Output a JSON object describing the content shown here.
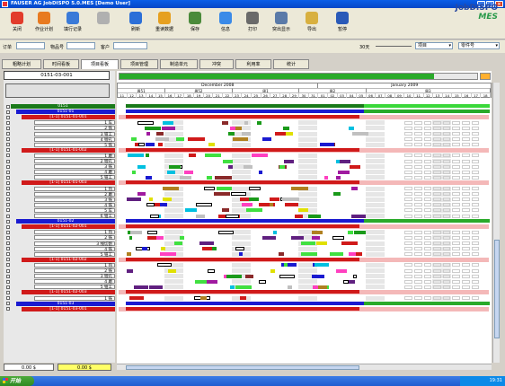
{
  "window": {
    "title": "FAUSER AG JobDISPO 5.0.MES    [Demo User]"
  },
  "toolbar": {
    "items": [
      {
        "label": "关闭",
        "color": "#e23c2b",
        "icon": "exit-icon"
      },
      {
        "label": "作业计划",
        "color": "#e87a20",
        "icon": "plan-icon"
      },
      {
        "label": "填行记录",
        "color": "#3a7ad8",
        "icon": "record-icon"
      },
      {
        "label": "",
        "color": "#b0b0b0",
        "icon": "disabled-icon"
      },
      {
        "label": "刷新",
        "color": "#2b6fd8",
        "icon": "refresh-icon"
      },
      {
        "label": "重读数据",
        "color": "#e6a020",
        "icon": "reload-icon"
      },
      {
        "label": "保存",
        "color": "#4a8a3a",
        "icon": "save-icon"
      },
      {
        "label": "信息",
        "color": "#3a8ae8",
        "icon": "info-icon"
      },
      {
        "label": "打印",
        "color": "#6a6a6a",
        "icon": "print-icon"
      },
      {
        "label": "突出显示",
        "color": "#5a7aa8",
        "icon": "highlight-icon"
      },
      {
        "label": "导出",
        "color": "#d8b040",
        "icon": "export-icon"
      },
      {
        "label": "暂停",
        "color": "#2a5ab8",
        "icon": "pause-icon"
      }
    ]
  },
  "logo": {
    "line1": "JobDISPO",
    "line2": "MES"
  },
  "filters": {
    "order_label": "订单",
    "order_placeholder": "",
    "project_label": "物品号",
    "project_placeholder": "",
    "customer_label": "客户",
    "customer_placeholder": "",
    "days_label": "30天",
    "item_select": "项目",
    "part_select": "零件号"
  },
  "tabs": [
    "粗略计划",
    "时间看板",
    "项目看板",
    "项目管理",
    "制造单元",
    "冲突",
    "利用率",
    "统计"
  ],
  "active_tab": 2,
  "order_box": "0151-03-001",
  "timeline": {
    "months": [
      "December 2008",
      "January 2009"
    ],
    "weeks": [
      "周51",
      "周52",
      "周1",
      "周2",
      "周3"
    ],
    "days": [
      "11",
      "12",
      "13",
      "14",
      "15",
      "16",
      "17",
      "18",
      "19",
      "20",
      "21",
      "22",
      "23",
      "24",
      "25",
      "26",
      "27",
      "28",
      "29",
      "30",
      "31",
      "01",
      "02",
      "03",
      "04",
      "05",
      "06",
      "07",
      "08",
      "09",
      "10",
      "11",
      "12",
      "13",
      "14",
      "15",
      "16",
      "17",
      "18"
    ]
  },
  "tree": [
    {
      "label": "0151",
      "level": 0,
      "color": "#1a7a1a"
    },
    {
      "label": "0151-01",
      "level": 1,
      "color": "#1a1ad0"
    },
    {
      "label": "[1-1] 0151-01-001",
      "level": 2,
      "color": "#d01a1a"
    },
    {
      "label": "1 车",
      "level": 3,
      "color": "#ffffff"
    },
    {
      "label": "2 铣",
      "level": 3,
      "color": "#ffffff"
    },
    {
      "label": "3 钳工",
      "level": 3,
      "color": "#ffffff"
    },
    {
      "label": "4 镗孔",
      "level": 3,
      "color": "#ffffff"
    },
    {
      "label": "5 铣",
      "level": 3,
      "color": "#ffffff"
    },
    {
      "label": "[1-1] 0151-01-002",
      "level": 2,
      "color": "#d01a1a"
    },
    {
      "label": "1 磨",
      "level": 3,
      "color": "#ffffff"
    },
    {
      "label": "2 镗孔",
      "level": 3,
      "color": "#ffffff"
    },
    {
      "label": "3 铣",
      "level": 3,
      "color": "#ffffff"
    },
    {
      "label": "4 磨",
      "level": 3,
      "color": "#ffffff"
    },
    {
      "label": "5 钳工",
      "level": 3,
      "color": "#ffffff"
    },
    {
      "label": "[1-1] 0151-01-003",
      "level": 2,
      "color": "#d01a1a"
    },
    {
      "label": "1 热",
      "level": 3,
      "color": "#ffffff"
    },
    {
      "label": "2 磨",
      "level": 3,
      "color": "#ffffff"
    },
    {
      "label": "3 铣",
      "level": 3,
      "color": "#ffffff"
    },
    {
      "label": "4 铣",
      "level": 3,
      "color": "#ffffff"
    },
    {
      "label": "5 车",
      "level": 3,
      "color": "#ffffff"
    },
    {
      "label": "6 钳工",
      "level": 3,
      "color": "#ffffff"
    },
    {
      "label": "0151-02",
      "level": 1,
      "color": "#1a1ad0"
    },
    {
      "label": "[1-1] 0151-02-001",
      "level": 2,
      "color": "#d01a1a"
    },
    {
      "label": "1 热",
      "level": 3,
      "color": "#ffffff"
    },
    {
      "label": "2 铣",
      "level": 3,
      "color": "#ffffff"
    },
    {
      "label": "3 线切割",
      "level": 3,
      "color": "#ffffff"
    },
    {
      "label": "4 铣",
      "level": 3,
      "color": "#ffffff"
    },
    {
      "label": "5 钳工",
      "level": 3,
      "color": "#ffffff"
    },
    {
      "label": "[1-1] 0151-02-002",
      "level": 2,
      "color": "#d01a1a"
    },
    {
      "label": "1 热",
      "level": 3,
      "color": "#ffffff"
    },
    {
      "label": "2 铣",
      "level": 3,
      "color": "#ffffff"
    },
    {
      "label": "3 镗孔",
      "level": 3,
      "color": "#ffffff"
    },
    {
      "label": "4 磨",
      "level": 3,
      "color": "#ffffff"
    },
    {
      "label": "5 钳工",
      "level": 3,
      "color": "#ffffff"
    },
    {
      "label": "[1-1] 0151-02-003",
      "level": 2,
      "color": "#d01a1a"
    },
    {
      "label": "1 铣",
      "level": 3,
      "color": "#ffffff"
    },
    {
      "label": "0151-03",
      "level": 1,
      "color": "#1a1ad0"
    },
    {
      "label": "[1-1] 0151-03-001",
      "level": 2,
      "color": "#d01a1a"
    }
  ],
  "totals": {
    "left": "0.00 $",
    "right": "0.00 $"
  },
  "taskbar": {
    "start": "开始",
    "clock": "19:31"
  },
  "palette": [
    "#d01a1a",
    "#1a1ad0",
    "#1a9a1a",
    "#e0e000",
    "#a01aa0",
    "#00c0e0",
    "#ff40c0",
    "#b08020",
    "#40e040",
    "#8a2a2a",
    "#c0c0c0",
    "#602080"
  ]
}
